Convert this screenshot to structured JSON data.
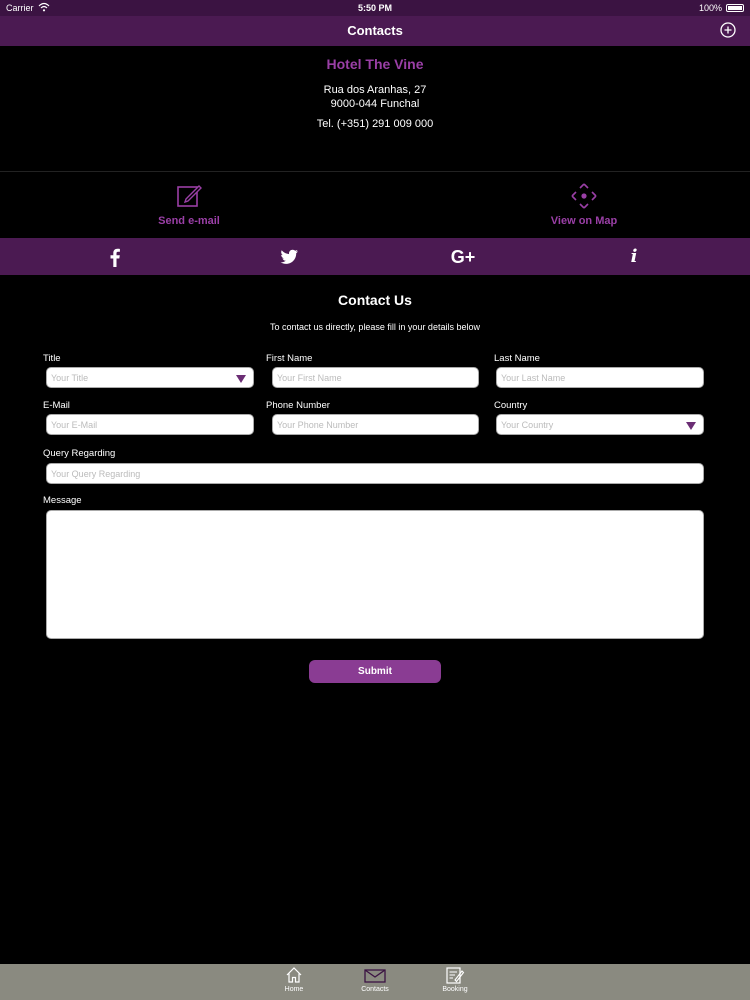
{
  "status_bar": {
    "carrier": "Carrier",
    "time": "5:50 PM",
    "battery": "100%"
  },
  "nav": {
    "title": "Contacts"
  },
  "hotel": {
    "name": "Hotel The Vine",
    "address_line1": "Rua dos Aranhas, 27",
    "address_line2": "9000-044 Funchal",
    "phone": "Tel. (+351) 291 009 000"
  },
  "actions": {
    "send_email": "Send e-mail",
    "view_map": "View on Map"
  },
  "social": {
    "google": "G+",
    "info": "i"
  },
  "form": {
    "title": "Contact Us",
    "intro": "To contact us directly, please fill in your details below",
    "title_label": "Title",
    "title_placeholder": "Your Title",
    "first_name_label": "First Name",
    "first_name_placeholder": "Your First Name",
    "last_name_label": "Last Name",
    "last_name_placeholder": "Your Last Name",
    "email_label": "E-Mail",
    "email_placeholder": "Your E-Mail",
    "phone_label": "Phone Number",
    "phone_placeholder": "Your Phone Number",
    "country_label": "Country",
    "country_placeholder": "Your Country",
    "query_label": "Query Regarding",
    "query_placeholder": "Your Query Regarding",
    "message_label": "Message",
    "submit": "Submit"
  },
  "tabs": [
    {
      "label": "Home",
      "icon": "home-icon"
    },
    {
      "label": "Contacts",
      "icon": "envelope-icon"
    },
    {
      "label": "Booking",
      "icon": "booking-icon"
    }
  ],
  "colors": {
    "accent": "#9a3fa6",
    "nav_bg": "#4b1a52",
    "tab_bg": "#8a8a80"
  }
}
